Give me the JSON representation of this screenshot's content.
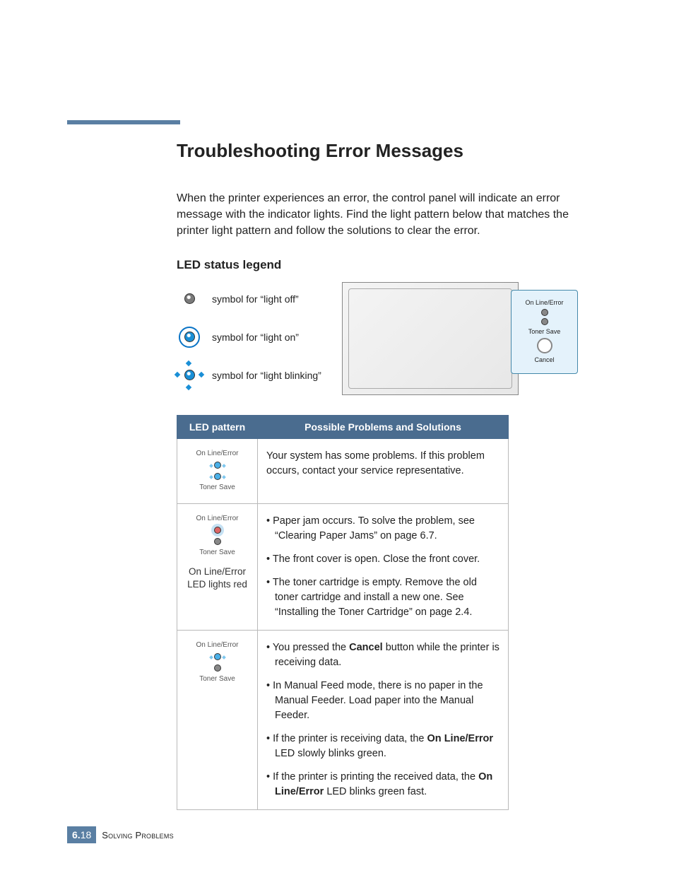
{
  "heading": "Troubleshooting Error Messages",
  "intro": "When the printer experiences an error, the control panel will indicate an error message with the indicator lights. Find the light pattern below that matches the printer light pattern and follow the solutions to clear the error.",
  "legend": {
    "title": "LED status legend",
    "items": [
      {
        "label": "symbol for “light off”"
      },
      {
        "label": "symbol for “light on”"
      },
      {
        "label": "symbol for “light blinking”"
      }
    ]
  },
  "panel": {
    "top_label": "On Line/Error",
    "mid_label": "Toner Save",
    "btn_label": "Cancel"
  },
  "table": {
    "col1": "LED pattern",
    "col2": "Possible Problems and Solutions",
    "rows": [
      {
        "panel": {
          "top": "On Line/Error",
          "bottom": "Toner Save"
        },
        "sub": "",
        "text_plain": "Your system has some problems. If this problem occurs, contact your service representative."
      },
      {
        "panel": {
          "top": "On Line/Error",
          "bottom": "Toner Save"
        },
        "sub": "On Line/Error LED lights red",
        "bullets": [
          "Paper jam occurs. To solve the problem, see “Clearing Paper Jams” on page 6.7.",
          "The front cover is open. Close the front cover.",
          "The toner cartridge is empty. Remove the old toner cartridge and install a new one. See “Installing the Toner Cartridge” on page 2.4."
        ]
      },
      {
        "panel": {
          "top": "On Line/Error",
          "bottom": "Toner Save"
        },
        "sub": "",
        "bullets_html": [
          "You pressed the <b>Cancel</b> button while the printer is receiving data.",
          "In Manual Feed mode, there is no paper in the Manual Feeder. Load paper into the Manual Feeder.",
          "If the printer is receiving data, the <b>On Line/Error</b> LED slowly blinks green.",
          "If the printer is printing the received data, the <b>On Line/Error</b> LED blinks green fast."
        ],
        "bullets": [
          "You pressed the Cancel button while the printer is receiving data.",
          "In Manual Feed mode, there is no paper in the Manual Feeder. Load paper into the Manual Feeder.",
          "If the printer is receiving data, the On Line/Error LED slowly blinks green.",
          "If the printer is printing the received data, the On Line/Error LED blinks green fast."
        ]
      }
    ]
  },
  "footer": {
    "chapter": "6.",
    "page": "18",
    "title": "Solving Problems"
  }
}
